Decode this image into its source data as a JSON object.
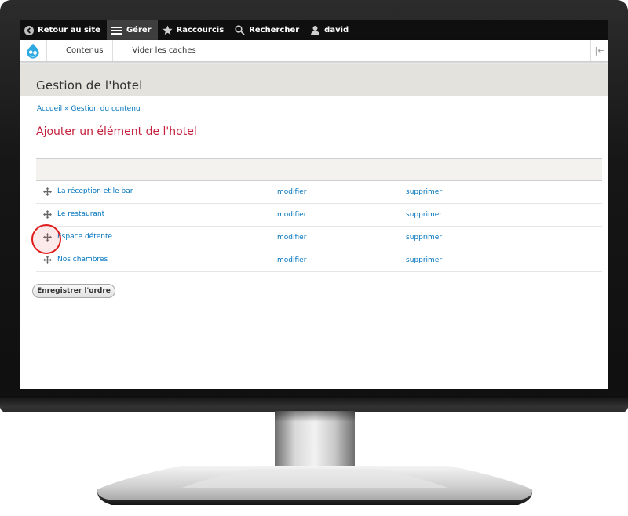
{
  "toolbar": {
    "back_label": "Retour au site",
    "manage_label": "Gérer",
    "shortcuts_label": "Raccourcis",
    "search_label": "Rechercher",
    "user_label": "david"
  },
  "tray": {
    "items": [
      "Contenus",
      "Vider les caches"
    ]
  },
  "page": {
    "title": "Gestion de l'hotel",
    "breadcrumb": [
      "Accueil",
      "Gestion du contenu"
    ],
    "breadcrumb_separator": "»",
    "add_link": "Ajouter un élément de l'hotel"
  },
  "table": {
    "rows": [
      {
        "title": "La réception et le bar",
        "edit": "modifier",
        "delete": "supprimer"
      },
      {
        "title": "Le restaurant",
        "edit": "modifier",
        "delete": "supprimer"
      },
      {
        "title": "Espace détente",
        "edit": "modifier",
        "delete": "supprimer"
      },
      {
        "title": "Nos chambres",
        "edit": "modifier",
        "delete": "supprimer"
      }
    ]
  },
  "save_button": "Enregistrer l'ordre",
  "colors": {
    "toolbar_bg": "#0f0f0f",
    "link": "#0074bd",
    "accent_title": "#c41e3a",
    "header_bg": "#e3e2dc",
    "highlight": "#e01b1b"
  },
  "icons": [
    "back-arrow-icon",
    "menu-icon",
    "star-icon",
    "search-icon",
    "user-icon",
    "drupal-logo-icon",
    "collapse-icon",
    "drag-handle-icon"
  ]
}
